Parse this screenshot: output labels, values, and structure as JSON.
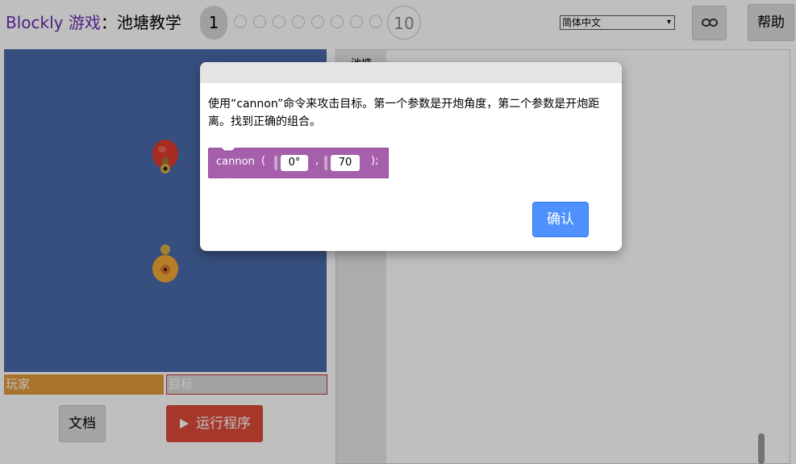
{
  "header": {
    "app_brand": "Blockly 游戏",
    "separator": "：",
    "level_name": "池塘教学",
    "current_level": "1",
    "last_level": "10",
    "language": "简体中文",
    "help_label": "帮助"
  },
  "game": {
    "player_label": "玩家",
    "target_label": "目标",
    "docs_label": "文档",
    "run_label": "运行程序"
  },
  "editor": {
    "tab_label": "池塘"
  },
  "dialog": {
    "instruction": "使用“cannon”命令来攻击目标。第一个参数是开炮角度，第二个参数是开炮距离。找到正确的组合。",
    "block": {
      "name": "cannon",
      "open_paren": "(",
      "angle": "0",
      "degree_sign": "°",
      "comma": ",",
      "distance": "70",
      "close": ");",
      "color": "#a55fab"
    },
    "confirm_label": "确认"
  },
  "colors": {
    "pond": "#4a6aa8",
    "player_duck": "#f4a836",
    "target_duck": "#e03a2e",
    "run_button": "#dd4b39",
    "confirm_button": "#4d90fe"
  },
  "icons": {
    "link": "link-icon",
    "play": "play-icon"
  }
}
